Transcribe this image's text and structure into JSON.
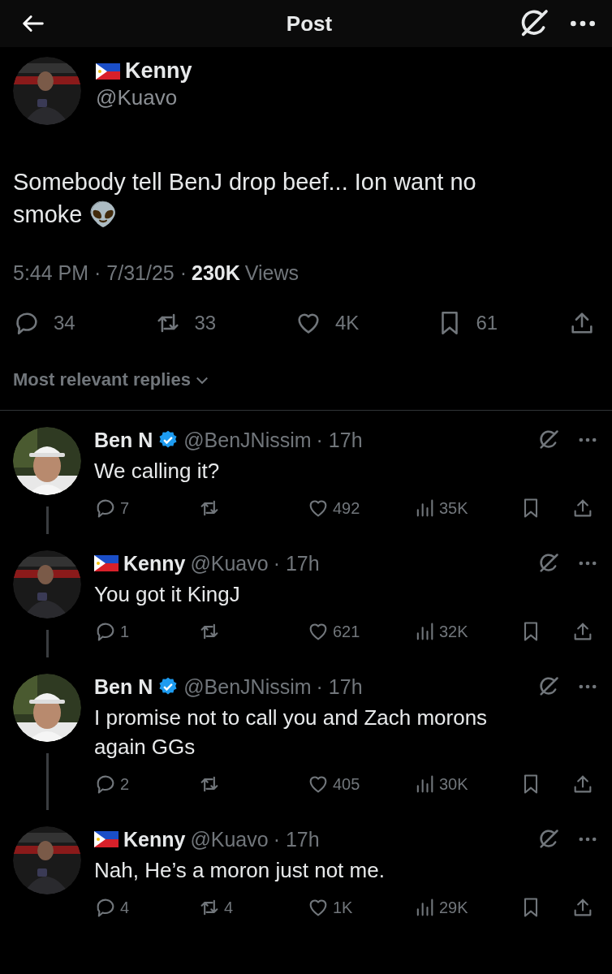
{
  "header": {
    "title": "Post"
  },
  "post": {
    "name": "Kenny",
    "flag": true,
    "handle": "@Kuavo",
    "text": "Somebody tell BenJ drop beef... Ion want no smoke 👽",
    "timestamp": "5:44 PM · 7/31/25 ·",
    "views_count": "230K",
    "views_label": "Views",
    "replies": "34",
    "reposts": "33",
    "likes": "4K",
    "bookmarks": "61"
  },
  "sort": {
    "label": "Most relevant replies"
  },
  "replies": [
    {
      "name": "Ben N",
      "flag": false,
      "verified": true,
      "handle": "@BenJNissim",
      "time": "· 17h",
      "text": "We calling it?",
      "replies": "7",
      "likes": "492",
      "views": "35K"
    },
    {
      "name": "Kenny",
      "flag": true,
      "verified": false,
      "handle": "@Kuavo",
      "time": "· 17h",
      "text": "You got it KingJ",
      "replies": "1",
      "likes": "621",
      "views": "32K"
    },
    {
      "name": "Ben N",
      "flag": false,
      "verified": true,
      "handle": "@BenJNissim",
      "time": "· 17h",
      "text": "I promise not to call you and Zach morons again GGs",
      "replies": "2",
      "likes": "405",
      "views": "30K"
    },
    {
      "name": "Kenny",
      "flag": true,
      "verified": false,
      "handle": "@Kuavo",
      "time": "· 17h",
      "text": "Nah, He’s a moron just not me.",
      "replies": "4",
      "reposts": "4",
      "likes": "1K",
      "views": "29K"
    }
  ]
}
